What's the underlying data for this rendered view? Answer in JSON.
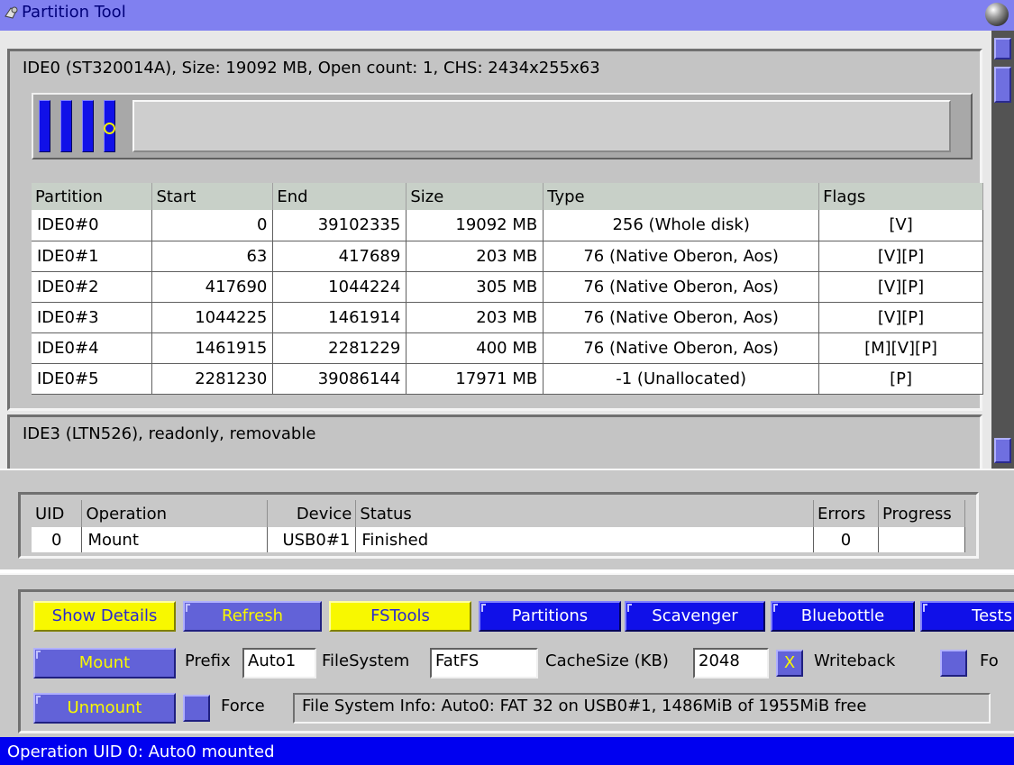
{
  "window": {
    "title": "Partition Tool"
  },
  "disk1": {
    "info": "IDE0 (ST320014A), Size: 19092 MB, Open count: 1, CHS: 2434x255x63",
    "columns": [
      "Partition",
      "Start",
      "End",
      "Size",
      "Type",
      "Flags"
    ],
    "rows": [
      [
        "IDE0#0",
        "0",
        "39102335",
        "19092 MB",
        "256 (Whole disk)",
        "[V]"
      ],
      [
        "IDE0#1",
        "63",
        "417689",
        "203 MB",
        "76 (Native Oberon, Aos)",
        "[V][P]"
      ],
      [
        "IDE0#2",
        "417690",
        "1044224",
        "305 MB",
        "76 (Native Oberon, Aos)",
        "[V][P]"
      ],
      [
        "IDE0#3",
        "1044225",
        "1461914",
        "203 MB",
        "76 (Native Oberon, Aos)",
        "[V][P]"
      ],
      [
        "IDE0#4",
        "1461915",
        "2281229",
        "400 MB",
        "76 (Native Oberon, Aos)",
        "[M][V][P]"
      ],
      [
        "IDE0#5",
        "2281230",
        "39086144",
        "17971 MB",
        "-1 (Unallocated)",
        "[P]"
      ]
    ]
  },
  "disk2": {
    "info": "IDE3 (LTN526), readonly, removable"
  },
  "operations": {
    "columns": [
      "UID",
      "Operation",
      "Device",
      "Status",
      "Errors",
      "Progress"
    ],
    "rows": [
      [
        "0",
        "Mount",
        "USB0#1",
        "Finished",
        "0",
        ""
      ]
    ]
  },
  "toolbar": {
    "show_details": "Show Details",
    "refresh": "Refresh",
    "fstools": "FSTools",
    "partitions": "Partitions",
    "scavenger": "Scavenger",
    "bluebottle": "Bluebottle",
    "tests": "Tests"
  },
  "mount_row": {
    "mount_button": "Mount",
    "prefix_label": "Prefix",
    "prefix_value": "Auto1",
    "filesystem_label": "FileSystem",
    "filesystem_value": "FatFS",
    "cachesize_label": "CacheSize (KB)",
    "cachesize_value": "2048",
    "writeback_check": "X",
    "writeback_label": "Writeback",
    "trailing_label": "Fo"
  },
  "unmount_row": {
    "unmount_button": "Unmount",
    "force_label": "Force",
    "fs_info": "File System Info:  Auto0: FAT 32 on USB0#1, 1486MiB of 1955MiB free"
  },
  "status": {
    "message": "Operation UID 0: Auto0 mounted"
  }
}
